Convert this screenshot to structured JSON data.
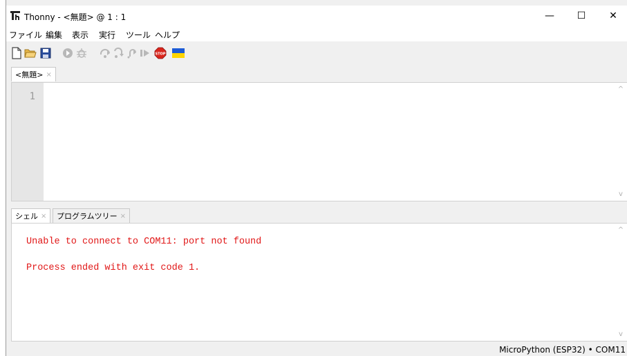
{
  "window": {
    "title": "Thonny  -  <無題>  @  1 : 1",
    "minimize_glyph": "—",
    "maximize_glyph": "☐",
    "close_glyph": "✕"
  },
  "menu": [
    "ファイル",
    "編集",
    "表示",
    "実行",
    "ツール",
    "ヘルプ"
  ],
  "toolbar": {
    "icons": [
      "new-file-icon",
      "open-folder-icon",
      "save-icon",
      "run-icon",
      "debug-icon",
      "step-over-icon",
      "step-into-icon",
      "step-out-icon",
      "resume-icon",
      "stop-icon",
      "ukraine-flag-icon"
    ],
    "stop_text": "STOP",
    "colors": {
      "stop": "#d9251c",
      "flag_blue": "#1c5bd6",
      "flag_yellow": "#ffd500",
      "disabled": "#b8b8b8"
    }
  },
  "editor": {
    "tab_label": "<無題>",
    "tab_close": "×",
    "line_numbers": [
      "1"
    ],
    "scroll_up": "^",
    "scroll_down": "v"
  },
  "bottom_tabs": [
    {
      "label": "シェル",
      "close": "×"
    },
    {
      "label": "プログラムツリー",
      "close": "×"
    }
  ],
  "shell": {
    "lines": [
      "Unable to connect to COM11: port not found",
      "Process ended with exit code 1."
    ],
    "text_color": "#e11717"
  },
  "status": {
    "text": "MicroPython (ESP32)  •  COM11"
  }
}
